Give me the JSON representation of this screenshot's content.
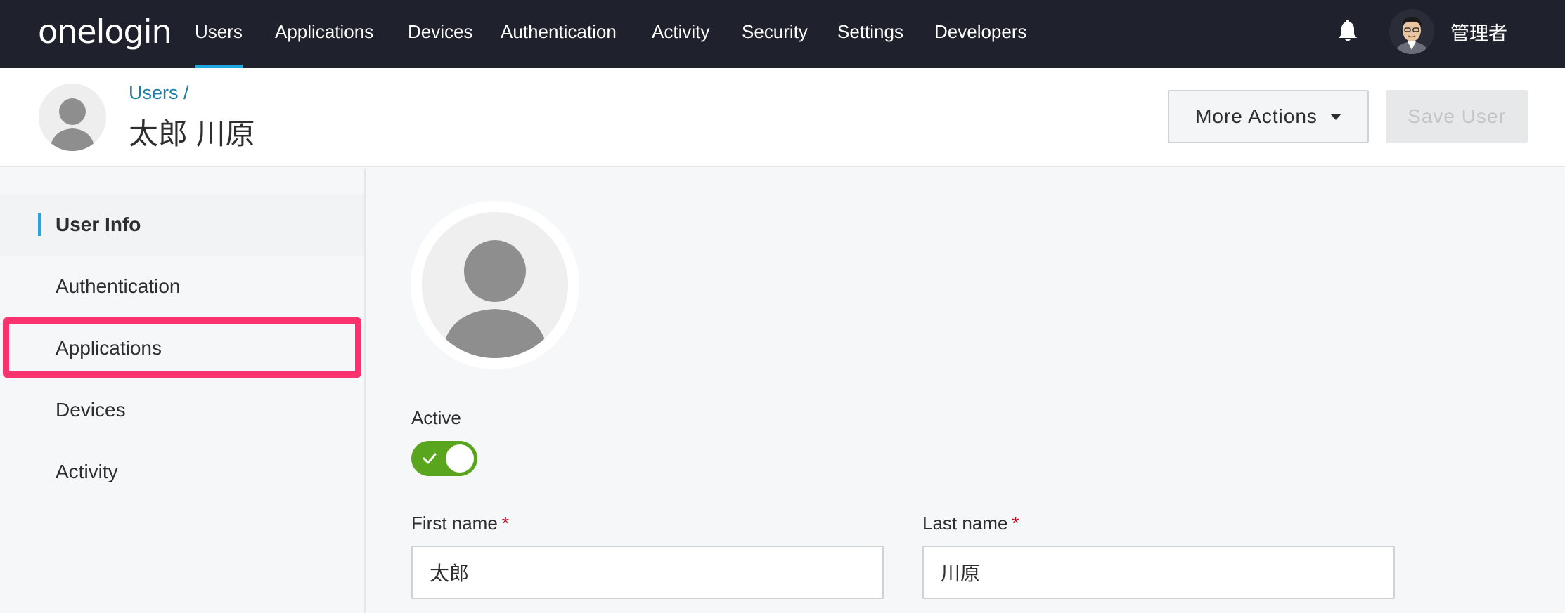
{
  "brand": {
    "logo_text": "onelogin"
  },
  "nav": {
    "items": [
      {
        "label": "Users",
        "active": true
      },
      {
        "label": "Applications"
      },
      {
        "label": "Devices"
      },
      {
        "label": "Authentication"
      },
      {
        "label": "Activity"
      },
      {
        "label": "Security"
      },
      {
        "label": "Settings"
      },
      {
        "label": "Developers"
      }
    ],
    "notification_icon": "bell-icon",
    "user_name": "管理者"
  },
  "header": {
    "breadcrumb": "Users /",
    "title": "太郎 川原",
    "more_actions_label": "More Actions",
    "save_label": "Save User"
  },
  "sidebar": {
    "items": [
      {
        "label": "User Info",
        "active": true
      },
      {
        "label": "Authentication"
      },
      {
        "label": "Applications",
        "highlighted": true
      },
      {
        "label": "Devices"
      },
      {
        "label": "Activity"
      }
    ]
  },
  "form": {
    "active_label": "Active",
    "active_value": true,
    "first_name_label": "First name",
    "first_name_value": "太郎",
    "last_name_label": "Last name",
    "last_name_value": "川原",
    "required_marker": "*"
  },
  "colors": {
    "nav_bg": "#1f222d",
    "accent": "#1ea7e1",
    "link": "#1a7ea6",
    "toggle_on": "#5aa51e",
    "highlight": "#f8336d",
    "required": "#d0021b"
  }
}
